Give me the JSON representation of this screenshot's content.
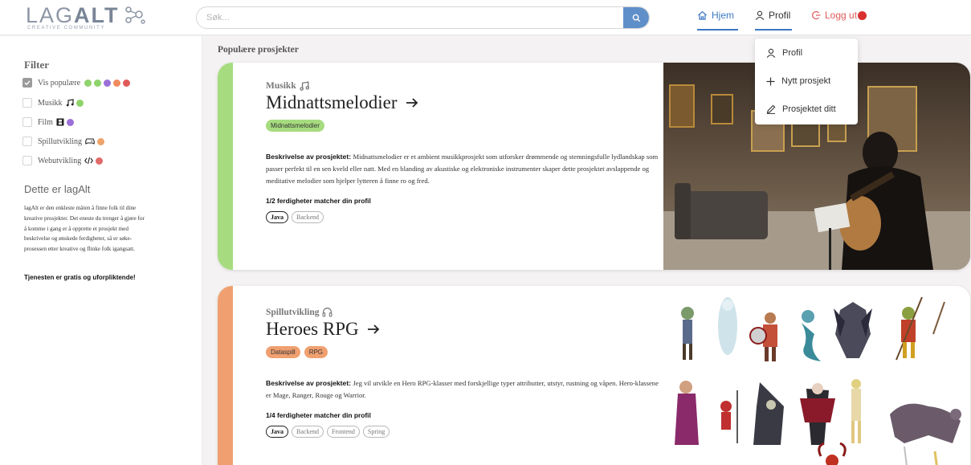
{
  "header": {
    "logo_text_light": "LAG",
    "logo_text_bold": "ALT",
    "logo_subtitle": "CREATIVE COMMUNITY",
    "search_placeholder": "Søk...",
    "nav": {
      "home": "Hjem",
      "profile": "Profil",
      "logout": "Logg ut"
    }
  },
  "dropdown": {
    "items": [
      {
        "label": "Profil",
        "icon": "user-icon"
      },
      {
        "label": "Nytt prosjekt",
        "icon": "plus-icon"
      },
      {
        "label": "Prosjektet ditt",
        "icon": "pencil-icon"
      }
    ]
  },
  "sidebar": {
    "filter_title": "Filter",
    "filters": [
      {
        "label": "Vis populære",
        "checked": true
      },
      {
        "label": "Musikk",
        "checked": false
      },
      {
        "label": "Film",
        "checked": false
      },
      {
        "label": "Spillutvikling",
        "checked": false
      },
      {
        "label": "Webutvikling",
        "checked": false
      }
    ],
    "about_title": "Dette er lagAlt",
    "about_text": "lagAlt er den enkleste måten å finne folk til dine kreative prosjekter. Det eneste du trenger å gjøre for å komme i gang er å opprette et prosjekt med beskrivelse og ønskede ferdigheter, så er søke-prosessen etter kreative og flinke folk igangsatt.",
    "about_strong": "Tjenesten er gratis og uforpliktende!"
  },
  "main": {
    "section_title": "Populære prosjekter",
    "projects": [
      {
        "category": "Musikk",
        "title": "Midnattsmelodier",
        "tags": [
          "Midnattsmelodier"
        ],
        "desc_label": "Beskrivelse av prosjektet",
        "description": "Midnattsmelodier er et ambient musikkprosjekt som utforsker drømmende og stemningsfulle lydlandskap som passer perfekt til en sen kveld eller natt. Med en blanding av akustiske og elektroniske instrumenter skaper dette prosjektet avslappende og meditative melodier som hjelper lytteren å finne ro og fred.",
        "match": "1/2 ferdigheter matcher din profil",
        "skills": [
          "Java",
          "Backend"
        ]
      },
      {
        "category": "Spillutvikling",
        "title": "Heroes RPG",
        "tags": [
          "Dataspill",
          "RPG"
        ],
        "desc_label": "Beskrivelse av prosjektet",
        "description": "Jeg vil utvikle en Hero RPG-klasser med forskjellige typer attributter, utstyr, rustning og våpen. Hero-klassene er Mage, Ranger, Rouge og Warrior.",
        "match": "1/4 ferdigheter matcher din profil",
        "skills": [
          "Java",
          "Backend",
          "Frontend",
          "Spring"
        ]
      }
    ]
  },
  "colors": {
    "popular_dots": [
      "#8ed36b",
      "#8ed36b",
      "#9b6fd8",
      "#f08a5d",
      "#e15a5a"
    ],
    "music": "#8ed36b",
    "film": "#9b6fd8",
    "game": "#f0a36b",
    "web": "#e06a6a",
    "accent": "#3c78c3"
  }
}
